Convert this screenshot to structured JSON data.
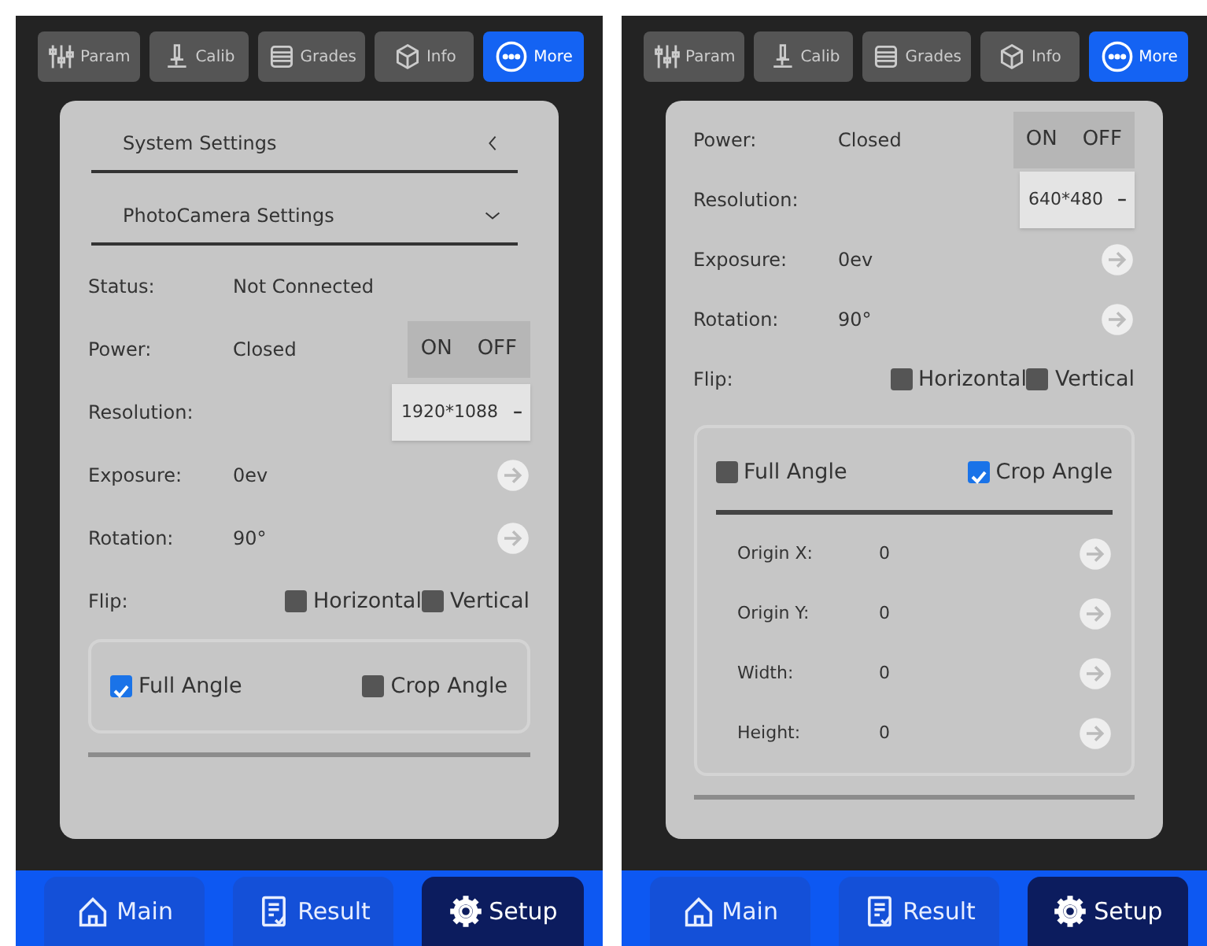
{
  "screens": [
    {
      "toolbar": [
        {
          "label": "Param",
          "selected": false
        },
        {
          "label": "Calib",
          "selected": false
        },
        {
          "label": "Grades",
          "selected": false
        },
        {
          "label": "Info",
          "selected": false
        },
        {
          "label": "More",
          "selected": true
        }
      ],
      "sections": [
        {
          "title": "System Settings",
          "expanded": false
        },
        {
          "title": "PhotoCamera Settings",
          "expanded": true
        }
      ],
      "rows": [
        {
          "kind": "text",
          "label": "Status:",
          "value": "Not Connected"
        },
        {
          "kind": "toggle",
          "label": "Power:",
          "value": "Closed",
          "on_label": "ON",
          "off_label": "OFF"
        },
        {
          "kind": "select",
          "label": "Resolution:",
          "value": "1920*1088"
        },
        {
          "kind": "arrow",
          "label": "Exposure:",
          "value": "0ev"
        },
        {
          "kind": "arrow",
          "label": "Rotation:",
          "value": "90°"
        },
        {
          "kind": "checks",
          "label": "Flip:",
          "options": [
            {
              "label": "Horizontal",
              "checked": false
            },
            {
              "label": "Vertical",
              "checked": false
            }
          ]
        }
      ],
      "angle": [
        {
          "label": "Full Angle",
          "checked": true
        },
        {
          "label": "Crop Angle",
          "checked": false
        }
      ],
      "nav": [
        {
          "label": "Main",
          "selected": false
        },
        {
          "label": "Result",
          "selected": false
        },
        {
          "label": "Setup",
          "selected": true
        }
      ]
    },
    {
      "toolbar": [
        {
          "label": "Param",
          "selected": false
        },
        {
          "label": "Calib",
          "selected": false
        },
        {
          "label": "Grades",
          "selected": false
        },
        {
          "label": "Info",
          "selected": false
        },
        {
          "label": "More",
          "selected": true
        }
      ],
      "rows": [
        {
          "kind": "toggle",
          "label": "Power:",
          "value": "Closed",
          "on_label": "ON",
          "off_label": "OFF"
        },
        {
          "kind": "select",
          "label": "Resolution:",
          "value": "640*480"
        },
        {
          "kind": "arrow",
          "label": "Exposure:",
          "value": "0ev"
        },
        {
          "kind": "arrow",
          "label": "Rotation:",
          "value": "90°"
        },
        {
          "kind": "checks",
          "label": "Flip:",
          "options": [
            {
              "label": "Horizontal",
              "checked": false
            },
            {
              "label": "Vertical",
              "checked": false
            }
          ]
        }
      ],
      "angle": [
        {
          "label": "Full Angle",
          "checked": false
        },
        {
          "label": "Crop Angle",
          "checked": true
        }
      ],
      "crop_rows": [
        {
          "label": "Origin X:",
          "value": "0"
        },
        {
          "label": "Origin Y:",
          "value": "0"
        },
        {
          "label": "Width:",
          "value": "0"
        },
        {
          "label": "Height:",
          "value": "0"
        }
      ],
      "nav": [
        {
          "label": "Main",
          "selected": false
        },
        {
          "label": "Result",
          "selected": false
        },
        {
          "label": "Setup",
          "selected": true
        }
      ]
    }
  ]
}
